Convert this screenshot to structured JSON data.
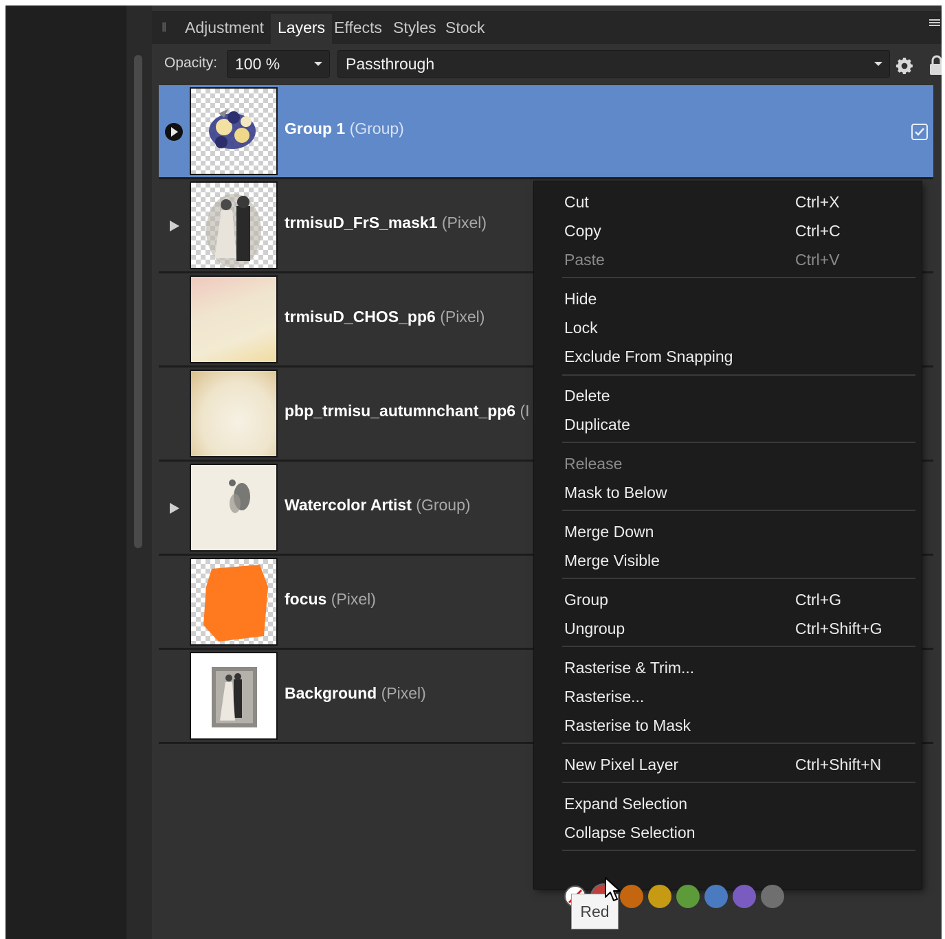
{
  "tabs": [
    "Adjustment",
    "Layers",
    "Effects",
    "Styles",
    "Stock"
  ],
  "active_tab": "Layers",
  "toolbar": {
    "opacity_label": "Opacity:",
    "opacity_value": "100 %",
    "blend_mode": "Passthrough"
  },
  "layers": [
    {
      "name": "Group 1",
      "type": "(Group)",
      "expander": true,
      "selected": true
    },
    {
      "name": "trmisuD_FrS_mask1",
      "type": "(Pixel)",
      "expander": true,
      "selected": false
    },
    {
      "name": "trmisuD_CHOS_pp6",
      "type": "(Pixel)",
      "expander": false,
      "selected": false
    },
    {
      "name": "pbp_trmisu_autumnchant_pp6",
      "type": "(I",
      "expander": false,
      "selected": false
    },
    {
      "name": "Watercolor Artist",
      "type": "(Group)",
      "expander": true,
      "selected": false
    },
    {
      "name": "focus",
      "type": "(Pixel)",
      "expander": false,
      "selected": false
    },
    {
      "name": "Background",
      "type": "(Pixel)",
      "expander": false,
      "selected": false
    }
  ],
  "context_menu": {
    "cut": {
      "label": "Cut",
      "shortcut": "Ctrl+X"
    },
    "copy": {
      "label": "Copy",
      "shortcut": "Ctrl+C"
    },
    "paste": {
      "label": "Paste",
      "shortcut": "Ctrl+V",
      "disabled": true
    },
    "hide": {
      "label": "Hide"
    },
    "lock": {
      "label": "Lock"
    },
    "exclude_snapping": {
      "label": "Exclude From Snapping"
    },
    "delete": {
      "label": "Delete"
    },
    "duplicate": {
      "label": "Duplicate"
    },
    "release": {
      "label": "Release",
      "disabled": true
    },
    "mask_below": {
      "label": "Mask to Below"
    },
    "merge_down": {
      "label": "Merge Down"
    },
    "merge_visible": {
      "label": "Merge Visible"
    },
    "group": {
      "label": "Group",
      "shortcut": "Ctrl+G"
    },
    "ungroup": {
      "label": "Ungroup",
      "shortcut": "Ctrl+Shift+G"
    },
    "rasterise_trim": {
      "label": "Rasterise & Trim..."
    },
    "rasterise": {
      "label": "Rasterise..."
    },
    "rasterise_mask": {
      "label": "Rasterise to Mask"
    },
    "new_pixel_layer": {
      "label": "New Pixel Layer",
      "shortcut": "Ctrl+Shift+N"
    },
    "expand_selection": {
      "label": "Expand Selection"
    },
    "collapse_selection": {
      "label": "Collapse Selection"
    }
  },
  "tag_colors": [
    {
      "name": "none",
      "hex": "#ffffff"
    },
    {
      "name": "red",
      "hex": "#c0403b"
    },
    {
      "name": "orange",
      "hex": "#c4660f"
    },
    {
      "name": "yellow",
      "hex": "#c69a12"
    },
    {
      "name": "green",
      "hex": "#5d9a3a"
    },
    {
      "name": "blue",
      "hex": "#4a7ac0"
    },
    {
      "name": "purple",
      "hex": "#7a5cc0"
    },
    {
      "name": "gray",
      "hex": "#6f6f6f"
    }
  ],
  "tooltip": "Red",
  "colors": {
    "selected_row": "#6089c9",
    "panel": "#323232",
    "menu": "#1c1c1c"
  }
}
